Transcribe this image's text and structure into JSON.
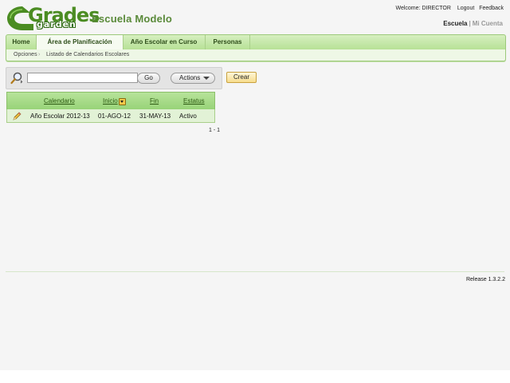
{
  "header": {
    "logo_text_main": "Grades",
    "logo_text_sub": "garden",
    "school_name": "Escuela Modelo",
    "welcome_label": "Welcome:",
    "user_name": "DIRECTOR",
    "logout_link": "Logout",
    "feedback_link": "Feedback",
    "school_switch_active": "Escuela",
    "school_switch_separator": "|",
    "school_switch_other": "Mi Cuenta"
  },
  "nav": {
    "tabs": [
      {
        "label": "Home"
      },
      {
        "label": "Área de Planificación"
      },
      {
        "label": "Año Escolar en Curso"
      },
      {
        "label": "Personas"
      }
    ],
    "active_tab": "Área de Planificación"
  },
  "breadcrumb": {
    "items": [
      "Opciones",
      "Listado de Calendarios Escolares"
    ]
  },
  "toolbar": {
    "search_value": "",
    "go_label": "Go",
    "actions_label": "Actions",
    "create_label": "Crear"
  },
  "table": {
    "columns": [
      "Calendario",
      "Inicio",
      "Fin",
      "Estatus"
    ],
    "rows": [
      {
        "calendario": "Año Escolar 2012-13",
        "inicio": "01-AGO-12",
        "fin": "31-MAY-13",
        "estatus": "Activo"
      }
    ],
    "pagination": "1 - 1"
  },
  "footer": {
    "release": "Release 1.3.2.2"
  },
  "colors": {
    "brand_green": "#4b8c22",
    "nav_bg": "#b7e196",
    "create_button": "#f7dd8d"
  }
}
